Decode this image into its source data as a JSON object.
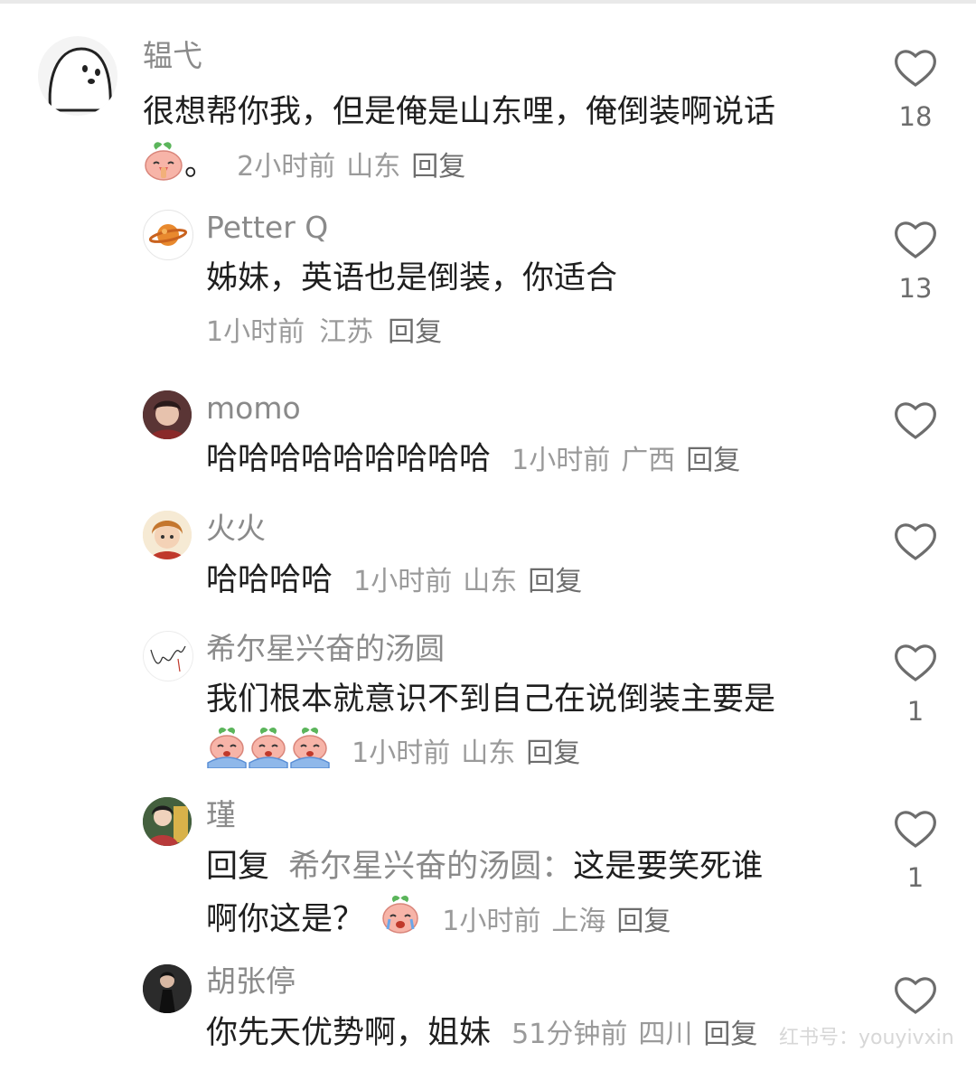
{
  "comments": [
    {
      "name": "辒弋",
      "text_line1": "很想帮你我，但是俺是山东哩，俺倒装啊说话",
      "text_line2": "。",
      "time": "2小时前",
      "location": "山东",
      "reply": "回复",
      "likes": "18"
    },
    {
      "name": "Petter Q",
      "text": "姊妹，英语也是倒装，你适合",
      "time": "1小时前",
      "location": "江苏",
      "reply": "回复",
      "likes": "13"
    },
    {
      "name": "momo",
      "text": "哈哈哈哈哈哈哈哈哈",
      "time": "1小时前",
      "location": "广西",
      "reply": "回复",
      "likes": ""
    },
    {
      "name": "火火",
      "text": "哈哈哈哈",
      "time": "1小时前",
      "location": "山东",
      "reply": "回复",
      "likes": ""
    },
    {
      "name": "希尔星兴奋的汤圆",
      "text": "我们根本就意识不到自己在说倒装主要是",
      "time": "1小时前",
      "location": "山东",
      "reply": "回复",
      "likes": "1"
    },
    {
      "name": "瑾",
      "reply_prefix": "回复",
      "mention": "希尔星兴奋的汤圆：",
      "text_line1": "这是要笑死谁",
      "text_line2": "啊你这是？",
      "time": "1小时前",
      "location": "上海",
      "reply": "回复",
      "likes": "1"
    },
    {
      "name": "胡张停",
      "text": "你先天优势啊，姐妹",
      "time": "51分钟前",
      "location": "四川",
      "reply": "回复",
      "likes": ""
    }
  ],
  "watermark": "红书号：youyivxin",
  "icons": {
    "like": "heart-outline-icon",
    "emoji_pray": "pray-emoji-icon",
    "emoji_cry": "crying-emoji-icon"
  },
  "colors": {
    "name": "#8a8a8a",
    "text": "#1f1f1f",
    "meta": "#9a9a9a",
    "heart": "#6d6d6d",
    "emoji_skin": "#f7b4a8",
    "emoji_leaf": "#5bb55b",
    "emoji_tears": "#8fb8ea"
  }
}
